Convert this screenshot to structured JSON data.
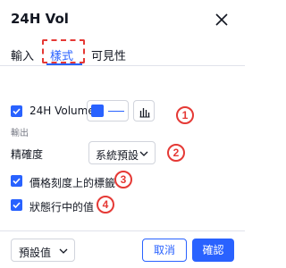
{
  "dialog": {
    "title": "24H Vol",
    "tabs": [
      {
        "label": "輸入"
      },
      {
        "label": "樣式"
      },
      {
        "label": "可見性"
      }
    ],
    "active_tab": "樣式",
    "volume": {
      "label": "24H Volume",
      "checked": true,
      "color": "#2962ff",
      "plot_type_icon": "bar-chart-icon"
    },
    "section_output": "輸出",
    "precision": {
      "label": "精確度",
      "value": "系統預設"
    },
    "checkboxes": [
      {
        "label": "價格刻度上的標籤",
        "checked": true
      },
      {
        "label": "狀態行中的值",
        "checked": true
      }
    ],
    "footer": {
      "defaults_label": "預設值",
      "cancel_label": "取消",
      "ok_label": "確認"
    },
    "annotations": [
      "1",
      "2",
      "3",
      "4"
    ],
    "colors": {
      "accent": "#2962ff",
      "annotation": "#e53935"
    }
  }
}
